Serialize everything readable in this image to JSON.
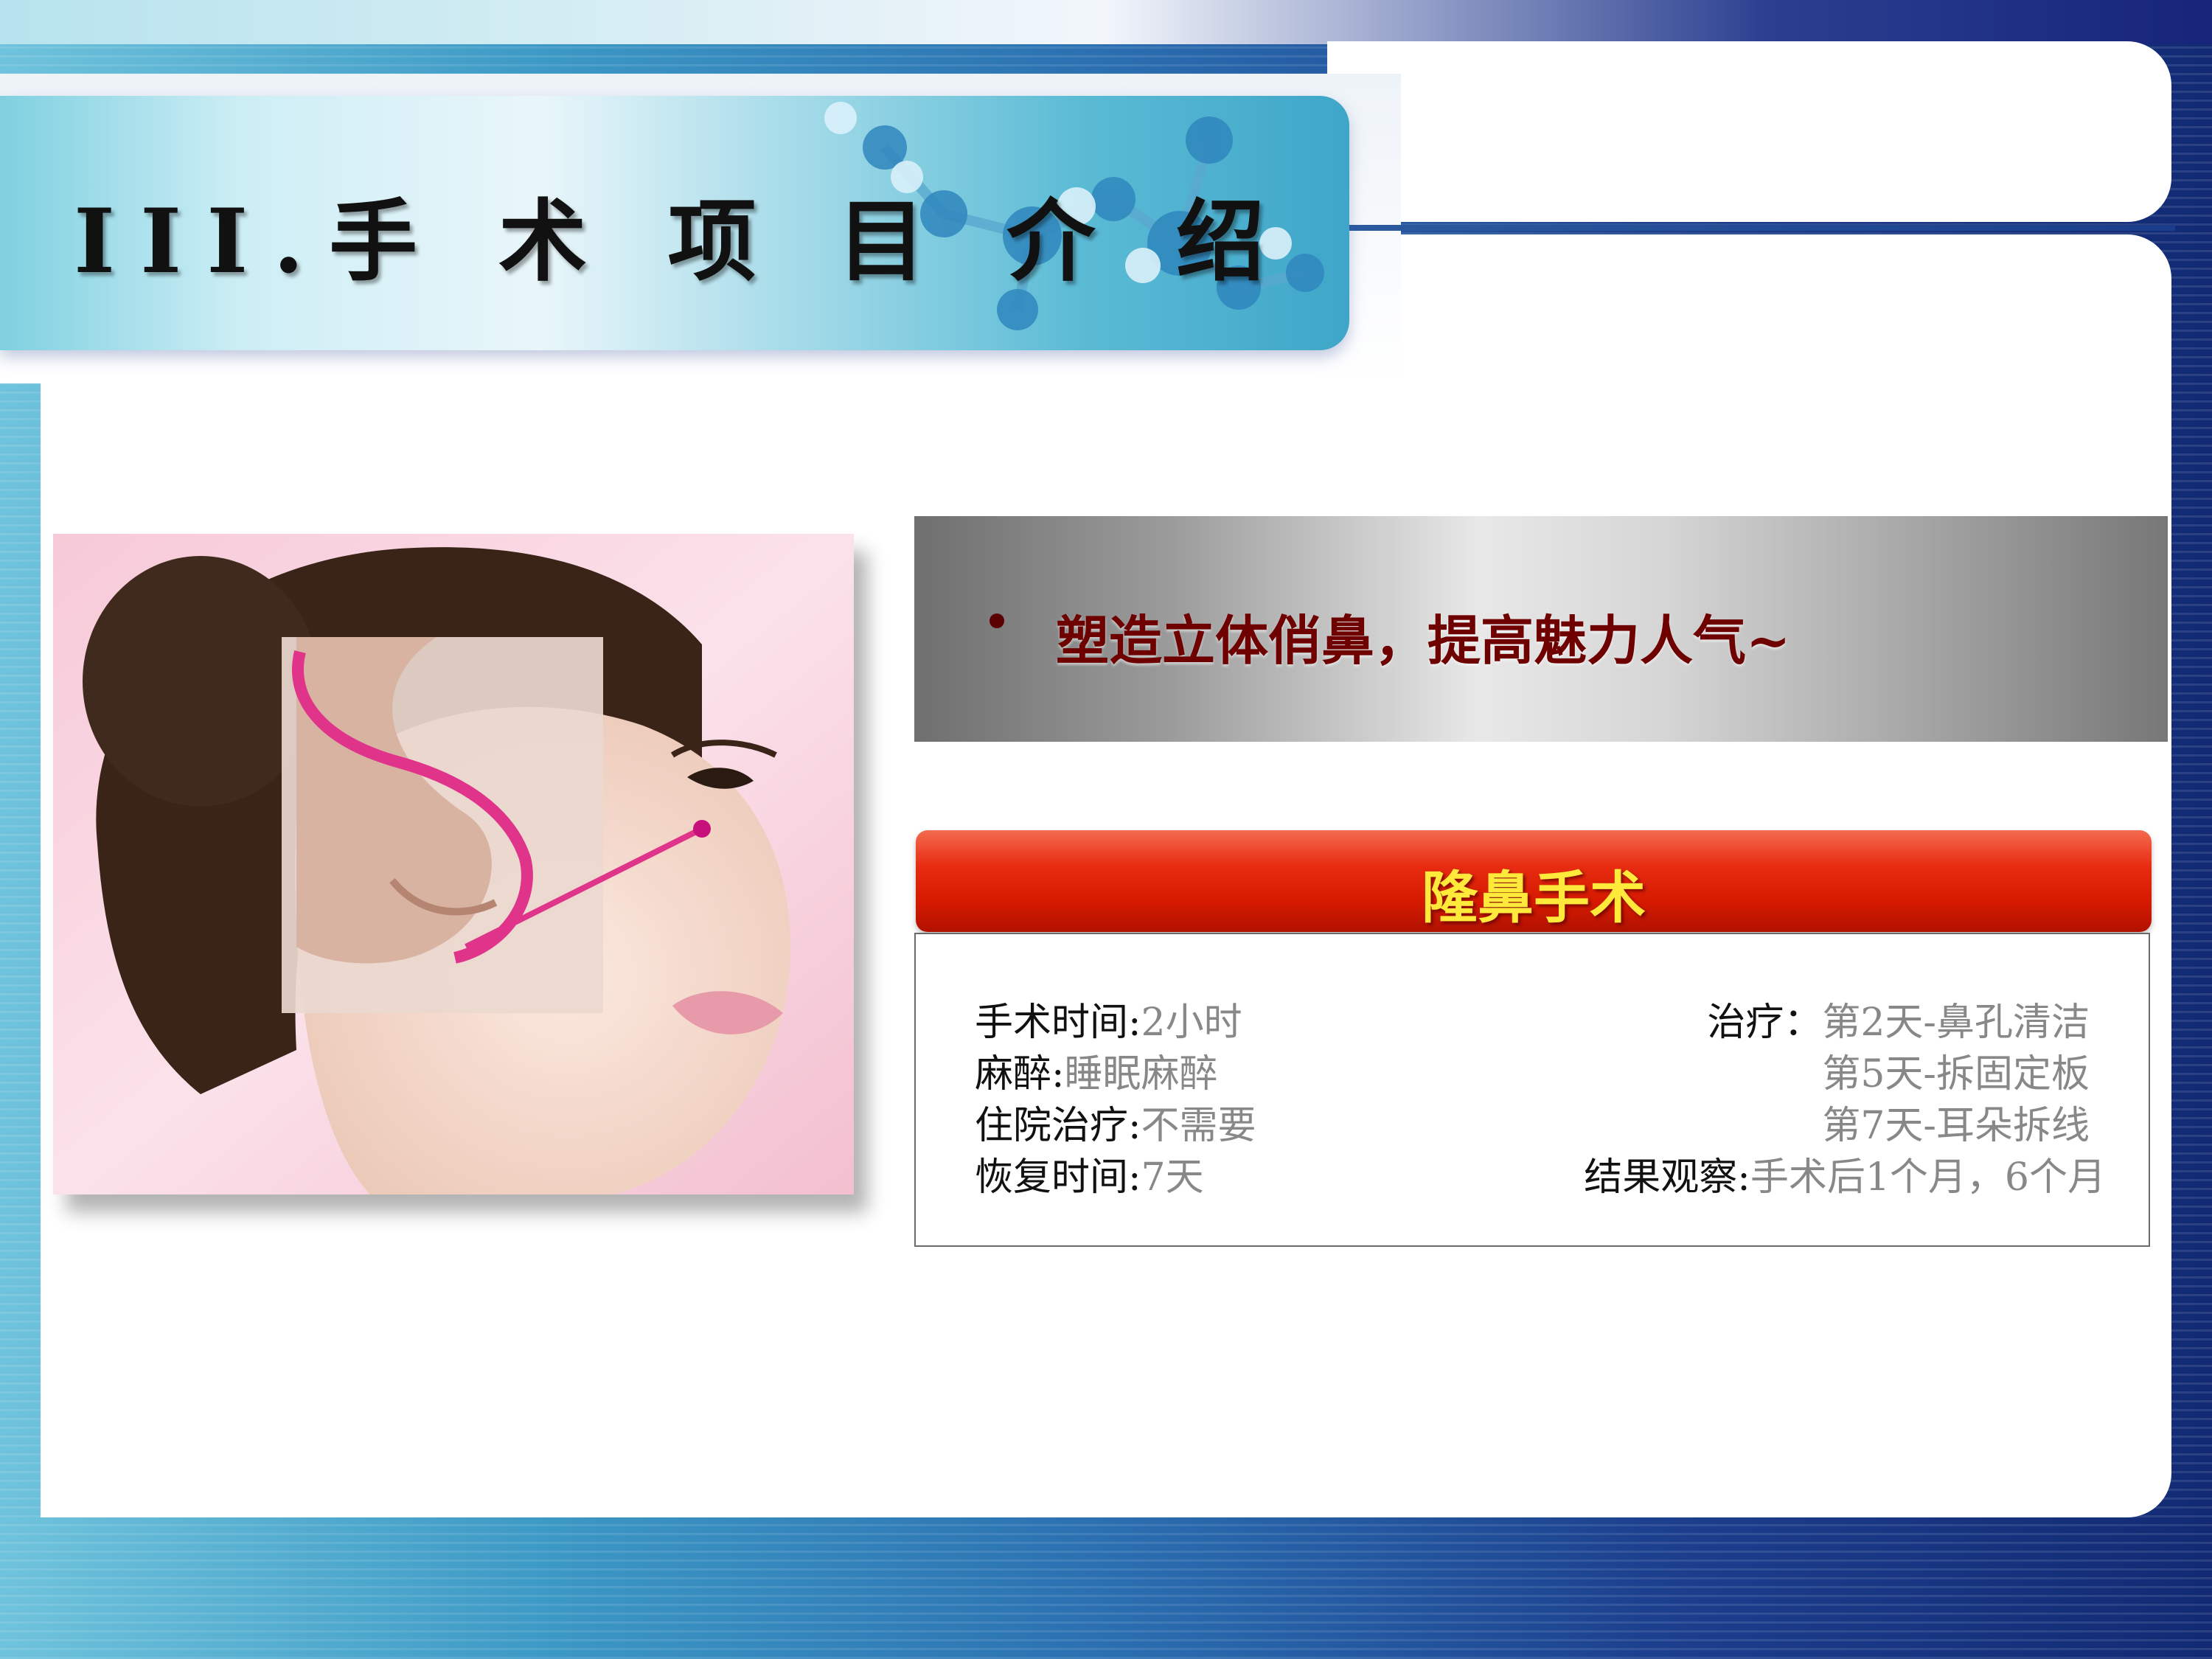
{
  "slide": {
    "title": "III.手 术 项 目 介 绍"
  },
  "slogan": {
    "bullet": "•",
    "text": "塑造立体俏鼻，提高魅力人气~"
  },
  "procedure": {
    "name": "隆鼻手术",
    "left": [
      {
        "label": "手术时间:",
        "value": "2小时"
      },
      {
        "label": "麻醉:",
        "value": "睡眠麻醉"
      },
      {
        "label": "住院治疗:",
        "value": "不需要"
      },
      {
        "label": "恢复时间:",
        "value": "7天"
      }
    ],
    "right": {
      "treatment_label": "治疗：",
      "treatment_values": [
        "第2天-鼻孔清洁",
        "第5天-拆固定板",
        "第7天-耳朵拆线"
      ],
      "result_label": "结果观察:",
      "result_value": "手术后1个月，6个月"
    }
  },
  "colors": {
    "accent_red": "#d61a00",
    "header_text": "#ffe93a",
    "slogan_text": "#6e0000"
  }
}
